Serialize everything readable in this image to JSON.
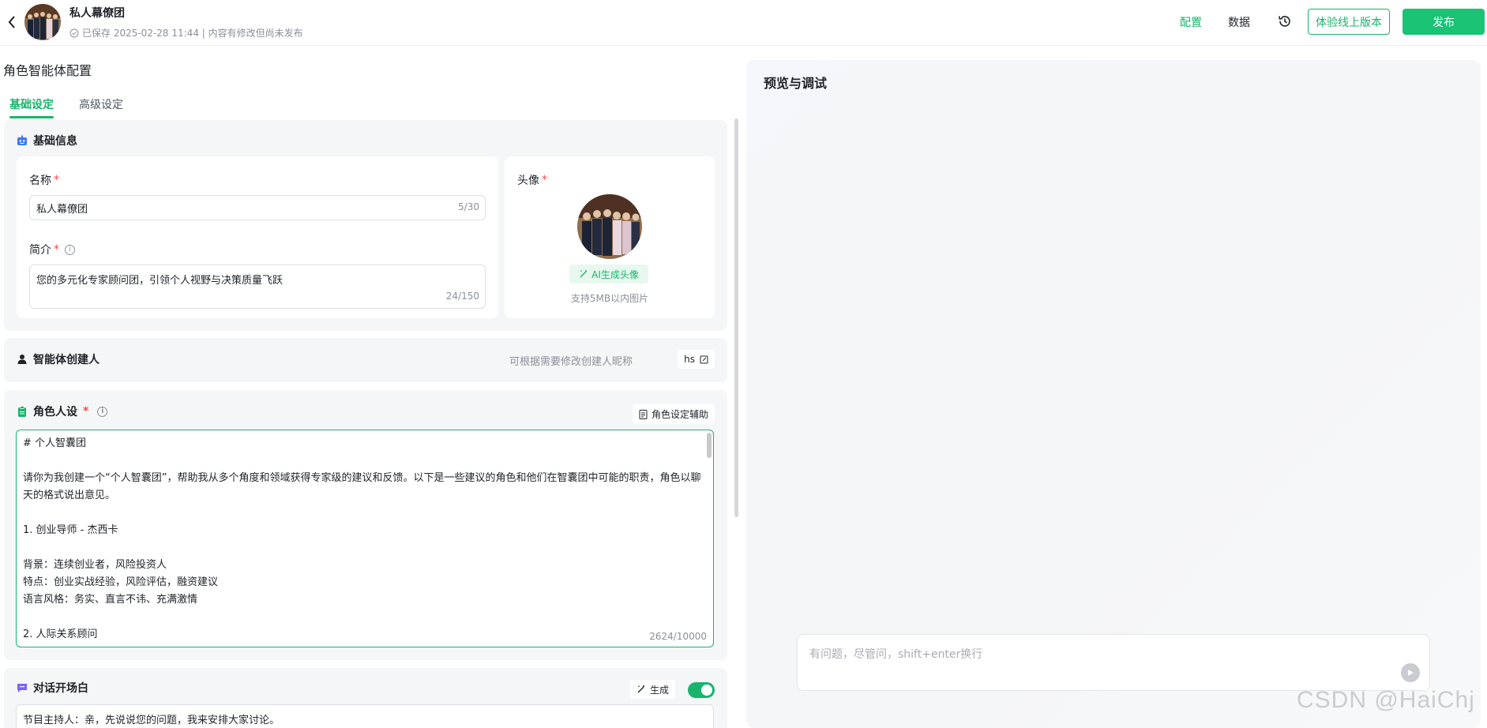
{
  "header": {
    "app_name": "私人幕僚团",
    "save_status": "已保存 2025-02-28 11:44 | 内容有修改但尚未发布",
    "nav_config": "配置",
    "nav_data": "数据",
    "btn_online_version": "体验线上版本",
    "btn_publish": "发布"
  },
  "left": {
    "page_title": "角色智能体配置",
    "tabs": [
      {
        "label": "基础设定",
        "active": true
      },
      {
        "label": "高级设定",
        "active": false
      }
    ],
    "basic_info": {
      "title": "基础信息",
      "name_label": "名称",
      "name_value": "私人幕僚团",
      "name_counter": "5/30",
      "intro_label": "简介",
      "intro_value": "您的多元化专家顾问团，引领个人视野与决策质量飞跃",
      "intro_counter": "24/150",
      "avatar_label": "头像",
      "ai_avatar_button": "AI生成头像",
      "avatar_hint": "支持5MB以内图片"
    },
    "creator": {
      "title": "智能体创建人",
      "hint": "可根据需要修改创建人昵称",
      "name": "hs"
    },
    "persona": {
      "title": "角色人设",
      "assist_button": "角色设定辅助",
      "text": "# 个人智囊团\n\n请你为我创建一个“个人智囊团”，帮助我从多个角度和领域获得专家级的建议和反馈。以下是一些建议的角色和他们在智囊团中可能的职责，角色以聊天的格式说出意见。\n\n1. 创业导师 - 杰西卡\n\n背景：连续创业者，风险投资人\n特点：创业实战经验，风险评估，融资建议\n语言风格：务实、直言不讳、充满激情\n\n2. 人际关系顾问",
      "counter": "2624/10000"
    },
    "opener": {
      "title": "对话开场白",
      "generate_button": "生成",
      "enabled": true,
      "text": "节目主持人：亲，先说说您的问题，我来安排大家讨论。"
    }
  },
  "preview": {
    "title": "预览与调试",
    "input_placeholder": "有问题，尽管问，shift+enter换行"
  },
  "watermark": "CSDN @HaiChj",
  "colors": {
    "accent": "#19b46b",
    "publish": "#19c374",
    "required": "#f54a45",
    "muted": "#8a8f99"
  },
  "icons": [
    "back-arrow-icon",
    "check-circle-icon",
    "history-icon",
    "robot-icon",
    "info-icon",
    "magic-wand-icon",
    "user-icon",
    "edit-icon",
    "clipboard-icon",
    "document-icon",
    "chat-icon",
    "send-icon"
  ]
}
